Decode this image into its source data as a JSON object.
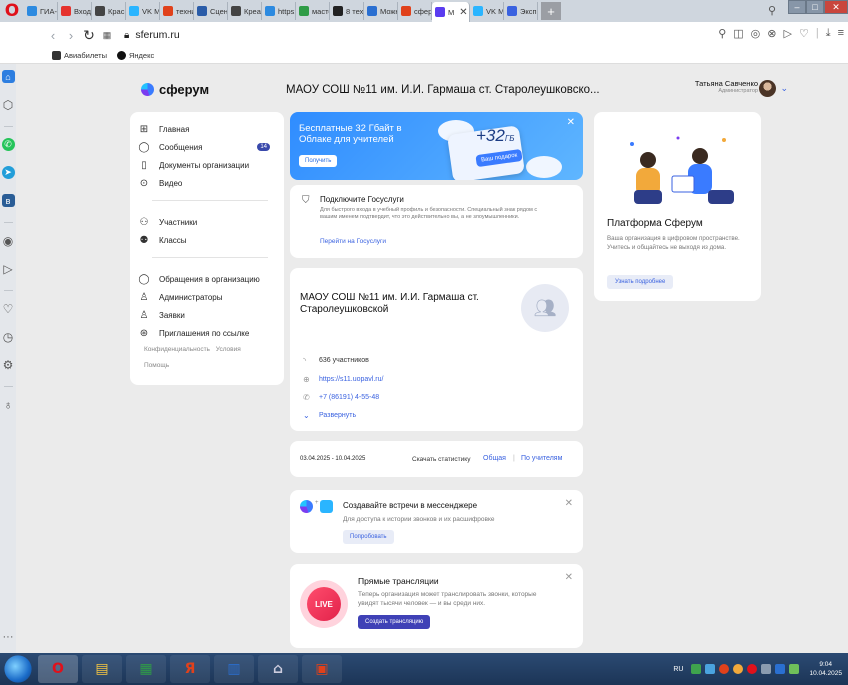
{
  "browser": {
    "tabs": [
      {
        "label": "ГИА-9",
        "color": "#2c8ae0"
      },
      {
        "label": "Входя",
        "color": "#e5322d"
      },
      {
        "label": "Красн",
        "color": "#444444"
      },
      {
        "label": "VK Ме",
        "color": "#2ab5ff"
      },
      {
        "label": "техни",
        "color": "#e0411b"
      },
      {
        "label": "Сцено",
        "color": "#2a5ca8"
      },
      {
        "label": "Креат",
        "color": "#444444"
      },
      {
        "label": "https:",
        "color": "#2c8ae0"
      },
      {
        "label": "масте",
        "color": "#2f9c47"
      },
      {
        "label": "8 техн",
        "color": "#222222"
      },
      {
        "label": "Можн",
        "color": "#2a6fd1"
      },
      {
        "label": "сферу",
        "color": "#e0411b"
      },
      {
        "label": "М",
        "color": "#5a3cf0"
      },
      {
        "label": "VK Ме",
        "color": "#2ab5ff"
      },
      {
        "label": "Экспр",
        "color": "#3a62e0"
      }
    ],
    "tab_prefixes": {
      "t9": "∞"
    },
    "active_tab_index": 12,
    "new_tab_label": "+",
    "url": "sferum.ru",
    "bookmarks": [
      {
        "label": "Авиабилеты",
        "color": "#333333"
      },
      {
        "label": "Яндекс",
        "color": "#111111"
      }
    ]
  },
  "header": {
    "logo_text": "сферум",
    "org_title": "МАОУ СОШ №11 им. И.И. Гармаша ст. Старолеушковско...",
    "user_name": "Татьяна Савченко",
    "user_role": "Администратор"
  },
  "menu": {
    "items": [
      {
        "label": "Главная",
        "icon": "grid-icon"
      },
      {
        "label": "Сообщения",
        "icon": "chat-icon",
        "badge": "14"
      },
      {
        "label": "Документы организации",
        "icon": "document-icon"
      },
      {
        "label": "Видео",
        "icon": "play-icon"
      }
    ],
    "items2": [
      {
        "label": "Участники",
        "icon": "people-icon"
      },
      {
        "label": "Классы",
        "icon": "class-icon"
      }
    ],
    "items3": [
      {
        "label": "Обращения в организацию",
        "icon": "chat-icon"
      },
      {
        "label": "Администраторы",
        "icon": "admin-icon"
      },
      {
        "label": "Заявки",
        "icon": "add-user-icon"
      },
      {
        "label": "Приглашения по ссылке",
        "icon": "link-icon"
      }
    ],
    "footer": [
      "Конфиденциальность",
      "Условия",
      "Помощь"
    ]
  },
  "promo": {
    "text": "Бесплатные 32 Гбайт в Облаке для учителей",
    "button": "Получить",
    "big": "+32",
    "unit": "ГБ",
    "gift": "Ваш подарок"
  },
  "gosuslugi": {
    "title": "Подключите Госуслуги",
    "desc": "Для быстрого входа в учебный профиль и безопасности. Специальный знак рядом с вашим именем подтвердит, что это действительно вы, а не злоумышленники.",
    "link": "Перейти на Госуслуги"
  },
  "org": {
    "name": "МАОУ СОШ №11 им. И.И. Гармаша ст. Старолеушковской",
    "members": "636 участников",
    "site": "https://s11.uopavl.ru/",
    "phone": "+7 (86191) 4-55-48",
    "expand": "Развернуть"
  },
  "stats": {
    "dates": "03.04.2025 - 10.04.2025",
    "label": "Скачать статистику",
    "general": "Общая",
    "sep": "|",
    "by_teachers": "По учителям"
  },
  "meetings": {
    "title": "Создавайте встречи в мессенджере",
    "desc": "Для доступа к истории звонков и их расшифровке",
    "button": "Попробовать"
  },
  "live": {
    "badge": "LIVE",
    "title": "Прямые трансляции",
    "desc": "Теперь организация может транслировать звонки, которые увидят тысячи человек — и вы среди них.",
    "button": "Создать трансляцию"
  },
  "platform": {
    "title": "Платформа Сферум",
    "desc": "Ваша организация в цифровом пространстве. Учитесь и общайтесь не выходя из дома.",
    "button": "Узнать подробнее"
  },
  "taskbar": {
    "lang": "RU",
    "time": "9:04",
    "date": "10.04.2025",
    "yandex_label": "Я"
  }
}
